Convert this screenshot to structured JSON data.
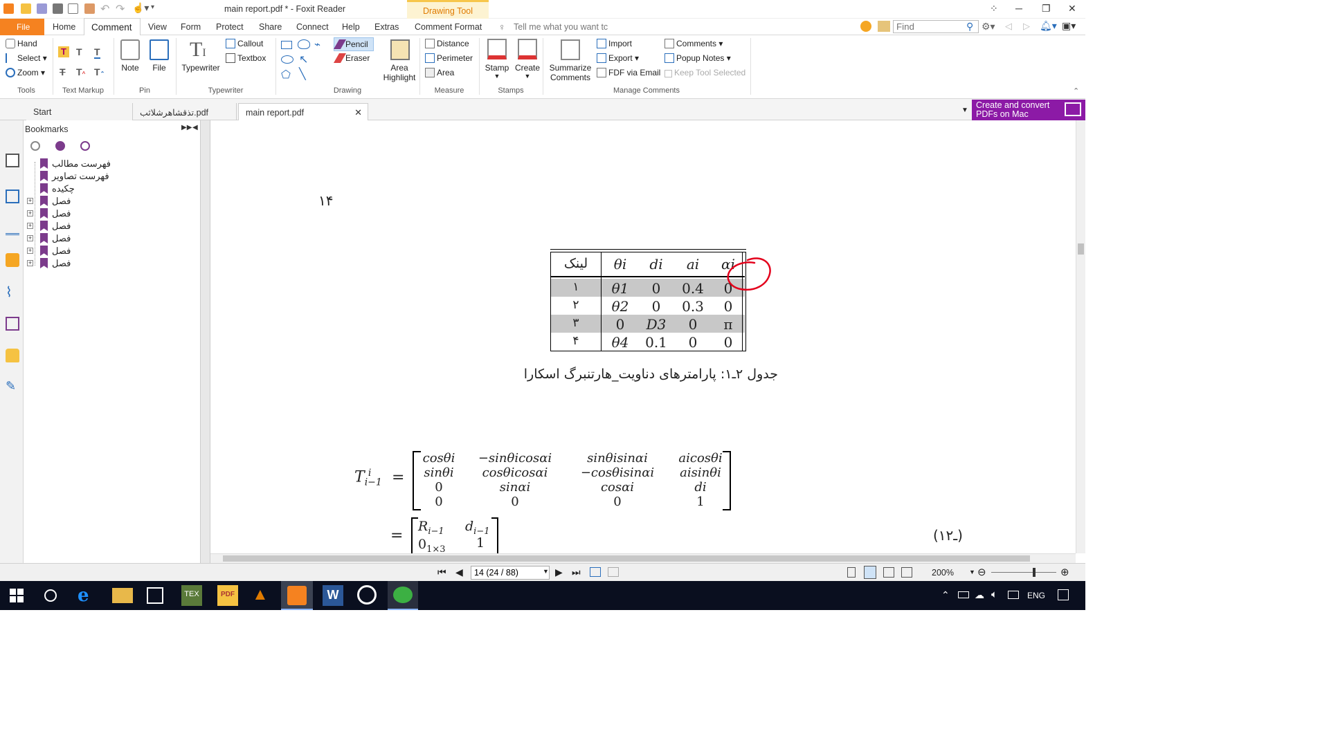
{
  "window": {
    "title": "main report.pdf * - Foxit Reader",
    "context_tab": "Drawing Tool",
    "controls": [
      "⁘",
      "─",
      "❐",
      "✕"
    ]
  },
  "menu": {
    "tabs": [
      "File",
      "Home",
      "Comment",
      "View",
      "Form",
      "Protect",
      "Share",
      "Connect",
      "Help",
      "Extras",
      "Comment Format"
    ],
    "active": "Comment",
    "tell_me": "Tell me what you want tc",
    "find_placeholder": "Find"
  },
  "ribbon": {
    "tools": {
      "hand": "Hand",
      "select": "Select",
      "zoom": "Zoom",
      "label": "Tools"
    },
    "text_markup": {
      "label": "Text Markup"
    },
    "pin": {
      "note": "Note",
      "file": "File",
      "label": "Pin"
    },
    "typewriter": {
      "typewriter": "Typewriter",
      "callout": "Callout",
      "textbox": "Textbox",
      "label": "Typewriter"
    },
    "drawing": {
      "pencil": "Pencil",
      "eraser": "Eraser",
      "area_highlight_1": "Area",
      "area_highlight_2": "Highlight",
      "label": "Drawing"
    },
    "measure": {
      "distance": "Distance",
      "perimeter": "Perimeter",
      "area": "Area",
      "label": "Measure"
    },
    "stamps": {
      "stamp": "Stamp",
      "create": "Create",
      "label": "Stamps"
    },
    "manage": {
      "summarize_1": "Summarize",
      "summarize_2": "Comments",
      "import": "Import",
      "export": "Export",
      "fdf": "FDF via Email",
      "comments": "Comments",
      "popup_notes": "Popup Notes",
      "keep_tool": "Keep Tool Selected",
      "label": "Manage Comments"
    }
  },
  "doc_tabs": {
    "start": "Start",
    "tab2": "تذقشاهرشلاثب.pdf",
    "tab3": "main report.pdf",
    "promo_1": "Create and convert",
    "promo_2": "PDFs on Mac"
  },
  "bookmarks": {
    "title": "Bookmarks",
    "items": [
      {
        "label": "فهرست مطالب",
        "expandable": false
      },
      {
        "label": "فهرست تصاویر",
        "expandable": false
      },
      {
        "label": "چکیده",
        "expandable": false
      },
      {
        "label": "فصل",
        "expandable": true
      },
      {
        "label": "فصل",
        "expandable": true
      },
      {
        "label": "فصل",
        "expandable": true
      },
      {
        "label": "فصل",
        "expandable": true
      },
      {
        "label": "فصل",
        "expandable": true
      },
      {
        "label": "فصل",
        "expandable": true
      }
    ]
  },
  "document": {
    "page_number": "۱۴",
    "table": {
      "headers": [
        "لینک",
        "θi",
        "di",
        "ai",
        "αi"
      ],
      "rows": [
        [
          "۱",
          "θ1",
          "0",
          "0.4",
          "0"
        ],
        [
          "۲",
          "θ2",
          "0",
          "0.3",
          "0"
        ],
        [
          "۳",
          "0",
          "D3",
          "0",
          "π"
        ],
        [
          "۴",
          "θ4",
          "0.1",
          "0",
          "0"
        ]
      ]
    },
    "caption": "جدول ۲ـ۱: پارامترهای دناویت_هارتنبرگ اسکارا",
    "equation_lhs": "T",
    "matrix": [
      [
        "cosθi",
        "−sinθicosαi",
        "sinθisinαi",
        "aicosθi"
      ],
      [
        "sinθi",
        "cosθicosαi",
        "−cosθisinαi",
        "aisinθi"
      ],
      [
        "0",
        "sinαi",
        "cosαi",
        "di"
      ],
      [
        "0",
        "0",
        "0",
        "1"
      ]
    ],
    "block_matrix": [
      [
        "R",
        "d"
      ],
      [
        "0",
        "1"
      ]
    ],
    "equation_number": "(۱ـ۲)"
  },
  "status": {
    "page_field": "14 (24 / 88)",
    "zoom": "200%"
  },
  "taskbar": {
    "language": "ENG"
  }
}
